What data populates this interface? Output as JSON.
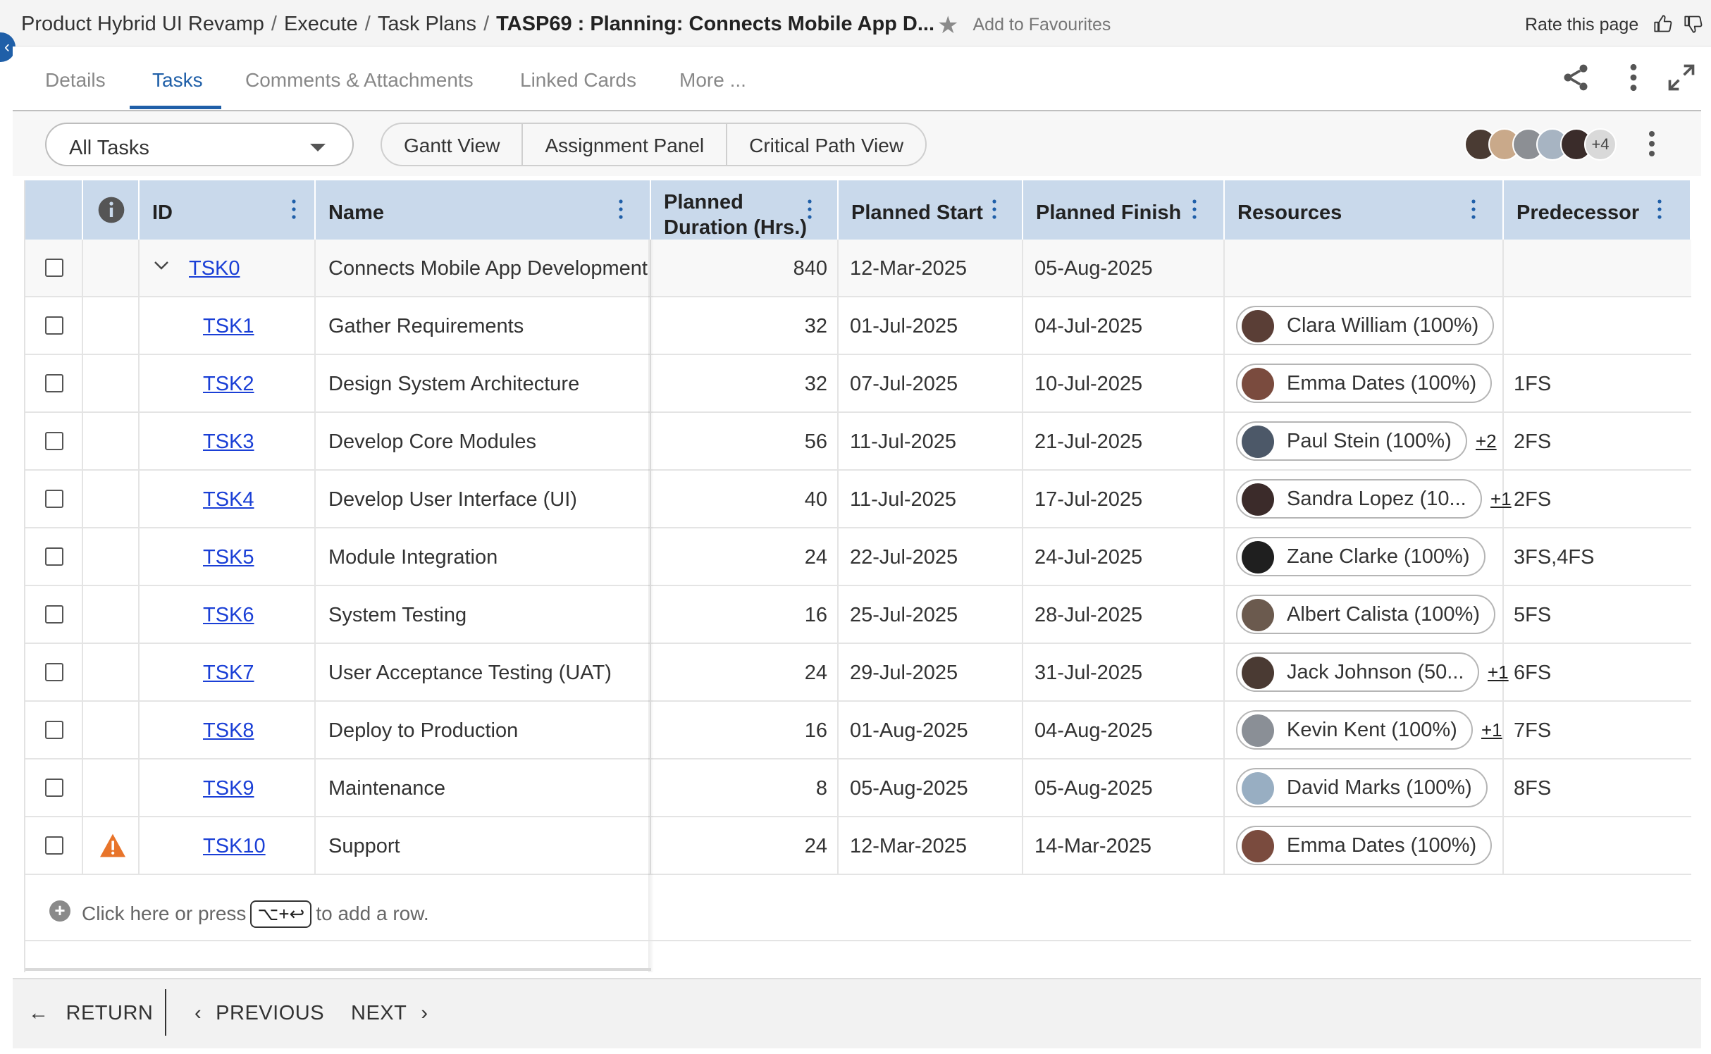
{
  "breadcrumb": {
    "items": [
      "Product Hybrid UI Revamp",
      "Execute",
      "Task Plans"
    ],
    "current": "TASP69 : Planning: Connects Mobile App D...",
    "separator": "/"
  },
  "favourite_label": "Add to Favourites",
  "rate_label": "Rate this page",
  "tabs": [
    {
      "label": "Details",
      "active": false
    },
    {
      "label": "Tasks",
      "active": true
    },
    {
      "label": "Comments & Attachments",
      "active": false
    },
    {
      "label": "Linked Cards",
      "active": false
    },
    {
      "label": "More ...",
      "active": false
    }
  ],
  "toolbar": {
    "filter_value": "All Tasks",
    "views": [
      "Gantt View",
      "Assignment Panel",
      "Critical Path View"
    ],
    "avatars_more": "+4"
  },
  "columns": {
    "id": "ID",
    "name": "Name",
    "duration": "Planned Duration (Hrs.)",
    "start": "Planned Start",
    "finish": "Planned Finish",
    "resources": "Resources",
    "predecessor": "Predecessor"
  },
  "rows": [
    {
      "id": "TSK0",
      "name": "Connects Mobile App Development",
      "duration": "840",
      "start": "12-Mar-2025",
      "finish": "05-Aug-2025",
      "resource": "",
      "more": "",
      "pred": "",
      "warn": false
    },
    {
      "id": "TSK1",
      "name": "Gather Requirements",
      "duration": "32",
      "start": "01-Jul-2025",
      "finish": "04-Jul-2025",
      "resource": "Clara William (100%)",
      "more": "",
      "pred": "",
      "warn": false
    },
    {
      "id": "TSK2",
      "name": "Design System Architecture",
      "duration": "32",
      "start": "07-Jul-2025",
      "finish": "10-Jul-2025",
      "resource": "Emma Dates (100%)",
      "more": "",
      "pred": "1FS",
      "warn": false
    },
    {
      "id": "TSK3",
      "name": "Develop Core Modules",
      "duration": "56",
      "start": "11-Jul-2025",
      "finish": "21-Jul-2025",
      "resource": "Paul Stein (100%)",
      "more": "+2",
      "pred": "2FS",
      "warn": false
    },
    {
      "id": "TSK4",
      "name": "Develop User Interface (UI)",
      "duration": "40",
      "start": "11-Jul-2025",
      "finish": "17-Jul-2025",
      "resource": "Sandra Lopez (10...",
      "more": "+1",
      "pred": "2FS",
      "warn": false
    },
    {
      "id": "TSK5",
      "name": "Module Integration",
      "duration": "24",
      "start": "22-Jul-2025",
      "finish": "24-Jul-2025",
      "resource": "Zane Clarke (100%)",
      "more": "",
      "pred": "3FS,4FS",
      "warn": false
    },
    {
      "id": "TSK6",
      "name": "System Testing",
      "duration": "16",
      "start": "25-Jul-2025",
      "finish": "28-Jul-2025",
      "resource": "Albert Calista (100%)",
      "more": "",
      "pred": "5FS",
      "warn": false
    },
    {
      "id": "TSK7",
      "name": "User Acceptance Testing (UAT)",
      "duration": "24",
      "start": "29-Jul-2025",
      "finish": "31-Jul-2025",
      "resource": "Jack Johnson (50...",
      "more": "+1",
      "pred": "6FS",
      "warn": false
    },
    {
      "id": "TSK8",
      "name": "Deploy to Production",
      "duration": "16",
      "start": "01-Aug-2025",
      "finish": "04-Aug-2025",
      "resource": "Kevin Kent (100%)",
      "more": "+1",
      "pred": "7FS",
      "warn": false
    },
    {
      "id": "TSK9",
      "name": "Maintenance",
      "duration": "8",
      "start": "05-Aug-2025",
      "finish": "05-Aug-2025",
      "resource": "David Marks (100%)",
      "more": "",
      "pred": "8FS",
      "warn": false
    },
    {
      "id": "TSK10",
      "name": "Support",
      "duration": "24",
      "start": "12-Mar-2025",
      "finish": "14-Mar-2025",
      "resource": "Emma Dates (100%)",
      "more": "",
      "pred": "",
      "warn": true
    }
  ],
  "add_row": {
    "before": "Click here or press",
    "key": "⌥+↩",
    "after": "to add a row."
  },
  "footer": {
    "return_label": "RETURN",
    "previous_label": "PREVIOUS",
    "next_label": "NEXT"
  },
  "colors": {
    "accent": "#1f5fa8",
    "header_bg": "#c9d9eb",
    "link": "#1a3fd6",
    "warning": "#e8742a"
  },
  "icons": {
    "favourite": "star-icon",
    "share": "share-icon",
    "more": "kebab-icon",
    "expand": "expand-icon",
    "info": "info-icon",
    "warning": "warning-icon",
    "add": "plus-circle-icon"
  }
}
